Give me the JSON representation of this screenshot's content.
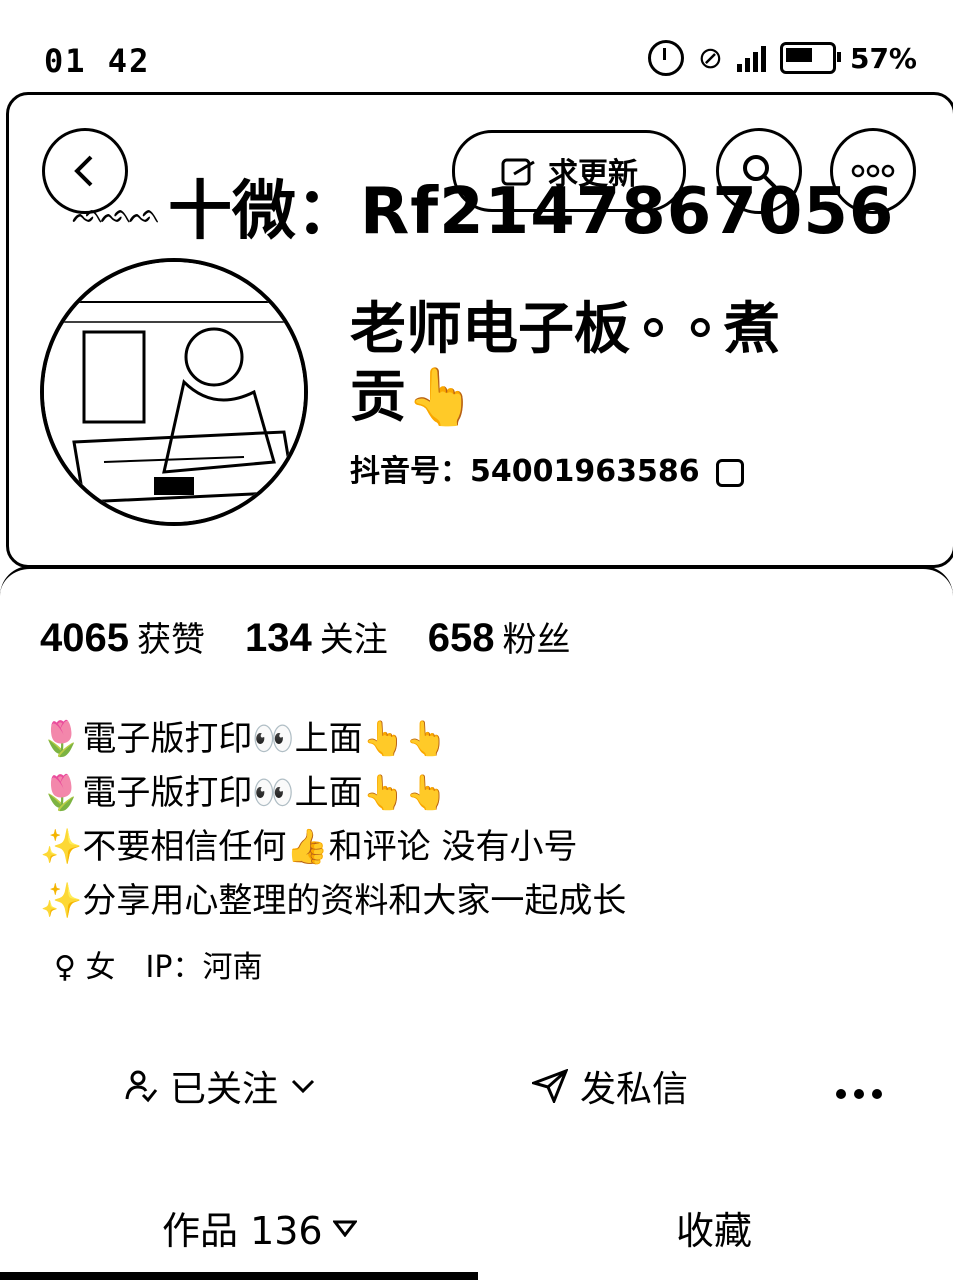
{
  "status_bar": {
    "time": "01 42",
    "battery": "57%"
  },
  "header": {
    "request_update_label": "求更新",
    "watermark_text": "十微：",
    "watermark_id": "Rf2147867056",
    "deco_text": "ᨒᨒᨒ"
  },
  "profile": {
    "title_line1": "老师电子板⚬⚬煮",
    "title_line2": "贡👆",
    "douyin_id": "抖音号：54001963586"
  },
  "stats": [
    {
      "num": "4065",
      "label": "获赞"
    },
    {
      "num": "134",
      "label": "关注"
    },
    {
      "num": "658",
      "label": "粉丝"
    }
  ],
  "bio": [
    "🌷電子版打印👀上面👆👆",
    "🌷電子版打印👀上面👆👆",
    "✨不要相信任何👍和评论 没有小号",
    "✨分享用心整理的资料和大家一起成长"
  ],
  "meta": {
    "gender": "♀ 女",
    "ip": "IP：河南"
  },
  "actions": {
    "followed": "已关注",
    "message": "发私信"
  },
  "tabs": {
    "works": "作品 136",
    "collect": "收藏"
  }
}
